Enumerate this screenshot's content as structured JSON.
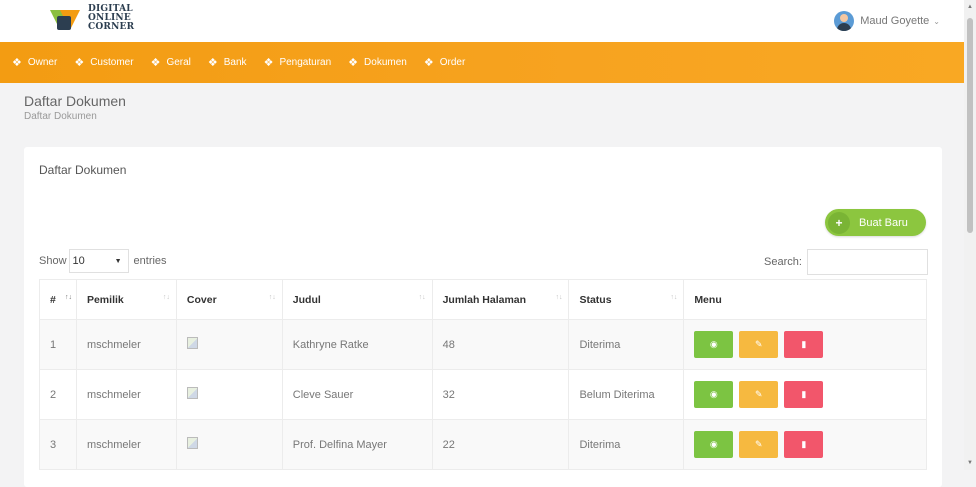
{
  "brand": {
    "line1": "DIGITAL",
    "line2": "ONLINE",
    "line3": "CORNER"
  },
  "user": {
    "name": "Maud Goyette",
    "chevron": "⌄"
  },
  "nav": [
    {
      "label": "Owner",
      "icon": "cube-icon"
    },
    {
      "label": "Customer",
      "icon": "cube-icon"
    },
    {
      "label": "Geral",
      "icon": "cube-icon"
    },
    {
      "label": "Bank",
      "icon": "cube-icon"
    },
    {
      "label": "Pengaturan",
      "icon": "cube-icon"
    },
    {
      "label": "Dokumen",
      "icon": "cube-icon"
    },
    {
      "label": "Order",
      "icon": "cube-icon"
    }
  ],
  "page": {
    "title": "Daftar Dokumen",
    "breadcrumb": "Daftar Dokumen"
  },
  "card": {
    "title": "Daftar Dokumen",
    "new_button": "Buat Baru",
    "show_label": "Show",
    "entries_value": "10",
    "entries_label": "entries",
    "search_label": "Search:"
  },
  "table": {
    "headers": [
      "#",
      "Pemilik",
      "Cover",
      "Judul",
      "Jumlah Halaman",
      "Status",
      "Menu"
    ],
    "rows": [
      {
        "no": "1",
        "owner": "mschmeler",
        "title": "Kathryne Ratke",
        "pages": "48",
        "status": "Diterima"
      },
      {
        "no": "2",
        "owner": "mschmeler",
        "title": "Cleve Sauer",
        "pages": "32",
        "status": "Belum Diterima"
      },
      {
        "no": "3",
        "owner": "mschmeler",
        "title": "Prof. Delfina Mayer",
        "pages": "22",
        "status": "Diterima"
      }
    ]
  },
  "colors": {
    "accent": "#f39c12",
    "view": "#7cc442",
    "edit": "#f6b940",
    "delete": "#f2566b",
    "new": "#8cc63f"
  }
}
